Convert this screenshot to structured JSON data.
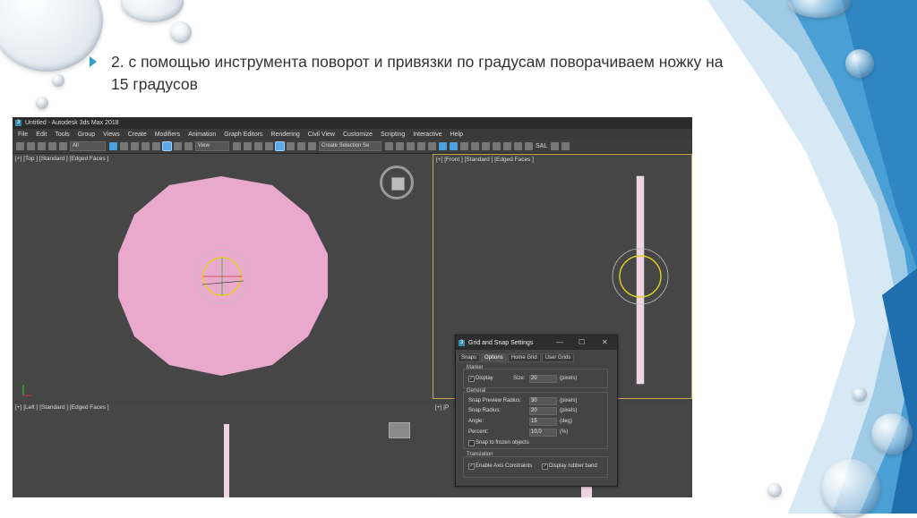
{
  "slide": {
    "text": "2. с помощью инструмента поворот и привязки по градусам поворачиваем ножку на 15 градусов"
  },
  "app": {
    "title": "Untitled - Autodesk 3ds Max 2018",
    "menu": [
      "File",
      "Edit",
      "Tools",
      "Group",
      "Views",
      "Create",
      "Modifiers",
      "Animation",
      "Graph Editors",
      "Rendering",
      "Civil View",
      "Customize",
      "Scripting",
      "Interactive",
      "Help"
    ],
    "toolbar": {
      "filter": "All",
      "view": "View",
      "selection_set": "Create Selection Se",
      "sal": "SAL"
    },
    "viewports": {
      "top": "[+] [Top ] [Standard ] [Edged Faces ]",
      "front": "[+] [Front ] [Standard ] [Edged Faces ]",
      "left": "[+] [Left ] [Standard ] [Edged Faces ]",
      "persp": "[+] [P"
    }
  },
  "dialog": {
    "title": "Grid and Snap Settings",
    "tabs": [
      "Snaps",
      "Options",
      "Home Grid",
      "User Grids"
    ],
    "marker_group": "Marker",
    "display_label": "Display",
    "size_label": "Size:",
    "size_value": "20",
    "size_unit": "(pixels)",
    "general_group": "General",
    "preview_radius_label": "Snap Preview Radius:",
    "preview_radius_value": "30",
    "preview_radius_unit": "(pixels)",
    "snap_radius_label": "Snap Radius:",
    "snap_radius_value": "20",
    "snap_radius_unit": "(pixels)",
    "angle_label": "Angle:",
    "angle_value": "15",
    "angle_unit": "(deg)",
    "percent_label": "Percent:",
    "percent_value": "10,0",
    "percent_unit": "(%)",
    "frozen_label": "Snap to frozen objects",
    "translation_group": "Translation",
    "axis_label": "Enable Axis Constraints",
    "rubber_label": "Display rubber band"
  },
  "colors": {
    "accent": "#34a0c8",
    "object_pink": "#e8a9cd",
    "viewport_bg": "#464646",
    "active_border": "#c9a64a"
  }
}
